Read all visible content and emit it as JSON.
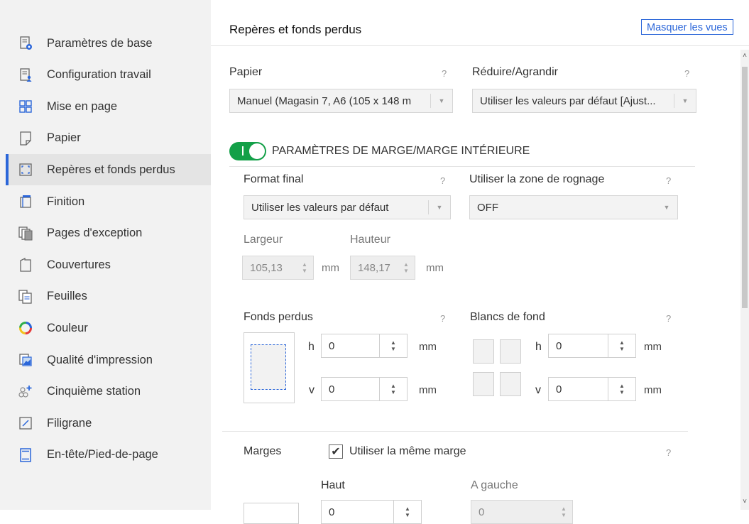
{
  "sidebar": {
    "items": [
      {
        "label": "Paramètres de base",
        "icon": "basic-settings-icon"
      },
      {
        "label": "Configuration travail",
        "icon": "job-setup-icon"
      },
      {
        "label": "Mise en page",
        "icon": "layout-grid-icon"
      },
      {
        "label": "Papier",
        "icon": "paper-icon"
      },
      {
        "label": "Repères et fonds perdus",
        "icon": "crop-marks-icon"
      },
      {
        "label": "Finition",
        "icon": "finishing-icon"
      },
      {
        "label": "Pages d'exception",
        "icon": "exception-pages-icon"
      },
      {
        "label": "Couvertures",
        "icon": "covers-icon"
      },
      {
        "label": "Feuilles",
        "icon": "sheets-icon"
      },
      {
        "label": "Couleur",
        "icon": "color-wheel-icon"
      },
      {
        "label": "Qualité d'impression",
        "icon": "print-quality-icon"
      },
      {
        "label": "Cinquième station",
        "icon": "fifth-station-icon"
      },
      {
        "label": "Filigrane",
        "icon": "watermark-icon"
      },
      {
        "label": "En-tête/Pied-de-page",
        "icon": "header-footer-icon"
      }
    ],
    "active_index": 4
  },
  "header": {
    "title": "Repères et fonds perdus",
    "hide_views_label": "Masquer les vues"
  },
  "paper": {
    "label": "Papier",
    "help": "?",
    "value": "Manuel (Magasin 7, A6 (105 x 148 m"
  },
  "reduce": {
    "label": "Réduire/Agrandir",
    "help": "?",
    "value": "Utiliser les valeurs par défaut [Ajust..."
  },
  "margins_section": {
    "toggle_on": true,
    "title": "PARAMÈTRES DE MARGE/MARGE INTÉRIEURE"
  },
  "final_format": {
    "label": "Format final",
    "help": "?",
    "value": "Utiliser les valeurs par défaut"
  },
  "trim_zone": {
    "label": "Utiliser la zone de rognage",
    "help": "?",
    "value": "OFF"
  },
  "size": {
    "width_label": "Largeur",
    "height_label": "Hauteur",
    "width_value": "105,13",
    "height_value": "148,17",
    "unit": "mm"
  },
  "bleed": {
    "label": "Fonds perdus",
    "help": "?",
    "h_label": "h",
    "v_label": "v",
    "h_value": "0",
    "v_value": "0",
    "unit": "mm"
  },
  "gutter": {
    "label": "Blancs de fond",
    "help": "?",
    "h_label": "h",
    "v_label": "v",
    "h_value": "0",
    "v_value": "0",
    "unit": "mm"
  },
  "margins": {
    "label": "Marges",
    "same_margin_label": "Utiliser la même marge",
    "same_margin_checked": true,
    "help": "?",
    "top_label": "Haut",
    "left_label": "A gauche",
    "top_value": "0",
    "left_value": "0"
  }
}
